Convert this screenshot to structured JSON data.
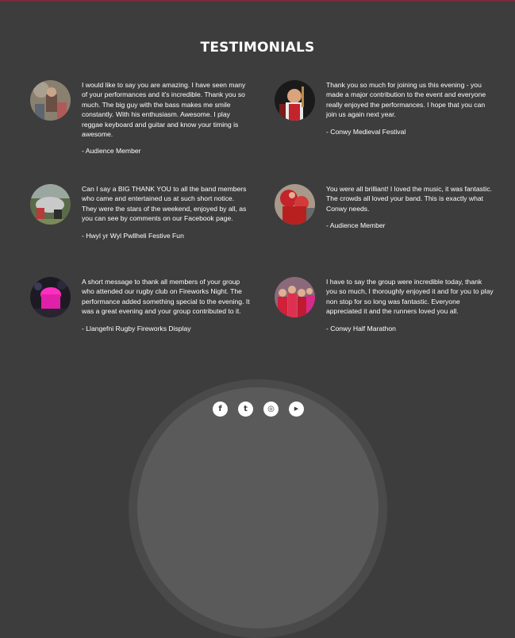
{
  "section": {
    "title": "TESTIMONIALS"
  },
  "testimonials": [
    {
      "quote": "I would like to say you are amazing. I have seen many of your performances and it's incredible. Thank you so much. The big guy with the bass makes me smile constantly. With his enthusiasm. Awesome. I play reggae keyboard and guitar and know your timing is awesome.",
      "author": "- Audience Member",
      "photo": "audience-member-photo"
    },
    {
      "quote": "Thank you so much for joining us this evening - you made a major contribution to the event and everyone really enjoyed the performances. I hope that you can join us again next year.",
      "author": "- Conwy Medieval Festival",
      "photo": "medieval-festival-photo"
    },
    {
      "quote": "Can I say a BIG THANK YOU to all the band members who came and entertained us at such short notice. They were the stars of the weekend, enjoyed by all, as you can see by comments on our Facebook page.",
      "author": "- Hwyl yr Wyl Pwllheli Festive Fun",
      "photo": "pwllheli-festive-photo"
    },
    {
      "quote": "You were all brilliant! I loved the music, it was fantastic. The crowds all loved your band. This is exactly what Conwy needs.",
      "author": "- Audience Member",
      "photo": "conwy-crowd-photo"
    },
    {
      "quote": "A short message to thank all members of your group who attended our rugby club on Fireworks Night. The performance added something special to the evening. It was a great evening and your group contributed to it.",
      "author": "- Llangefni Rugby Fireworks Display",
      "photo": "fireworks-night-photo"
    },
    {
      "quote": "I have to say the group were incredible today, thank you so much, I thoroughly enjoyed it and for you to play non stop for so long was fantastic. Everyone appreciated it and the runners loved you all.",
      "author": "- Conwy Half Marathon",
      "photo": "half-marathon-photo"
    }
  ],
  "footer": {
    "social": [
      {
        "name": "facebook-icon",
        "glyph": "f"
      },
      {
        "name": "twitter-icon",
        "glyph": "t"
      },
      {
        "name": "instagram-icon",
        "glyph": "◎"
      },
      {
        "name": "youtube-icon",
        "glyph": "▶"
      }
    ]
  },
  "colors": {
    "background": "#3d3d3d",
    "text": "#ffffff",
    "accent_line": "#7a2b3a"
  }
}
